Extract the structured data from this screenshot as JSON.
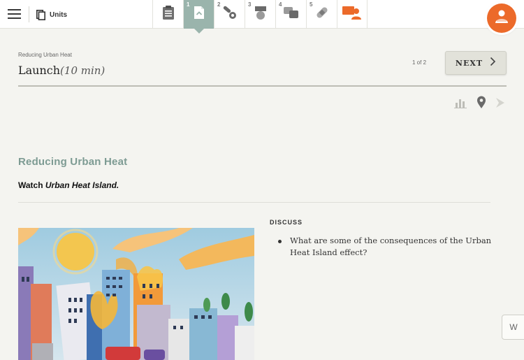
{
  "topbar": {
    "menu_icon": "hamburger-menu-icon",
    "units_label": "Units",
    "units_icon": "book-icon",
    "steps": [
      {
        "num": "",
        "icon": "clipboard-icon"
      },
      {
        "num": "1",
        "icon": "launch-document-icon",
        "active": true
      },
      {
        "num": "2",
        "icon": "tools-icon"
      },
      {
        "num": "3",
        "icon": "medal-icon"
      },
      {
        "num": "4",
        "icon": "chat-bubbles-icon"
      },
      {
        "num": "5",
        "icon": "bandage-icon"
      },
      {
        "num": "",
        "icon": "presenter-icon"
      }
    ],
    "avatar_icon": "teacher-avatar-icon",
    "colors": {
      "accent_orange": "#ec6a2a",
      "active_step": "#9ab4ac"
    }
  },
  "header": {
    "eyebrow": "Reducing Urban Heat",
    "title": "Launch",
    "time": "(10 min)",
    "pager": "1 of 2",
    "next_label": "NEXT",
    "tools": [
      "bar-chart-icon",
      "map-pin-icon",
      "pointer-icon"
    ]
  },
  "content": {
    "section_title": "Reducing Urban Heat",
    "watch_prefix": "Watch ",
    "watch_title": "Urban Heat Island.",
    "discuss_label": "DISCUSS",
    "discuss_items": [
      "What are some of the consequences of the Urban Heat Island effect?"
    ],
    "colors": {
      "section_title": "#7d9b93"
    }
  },
  "side_tab": {
    "label": "W"
  }
}
